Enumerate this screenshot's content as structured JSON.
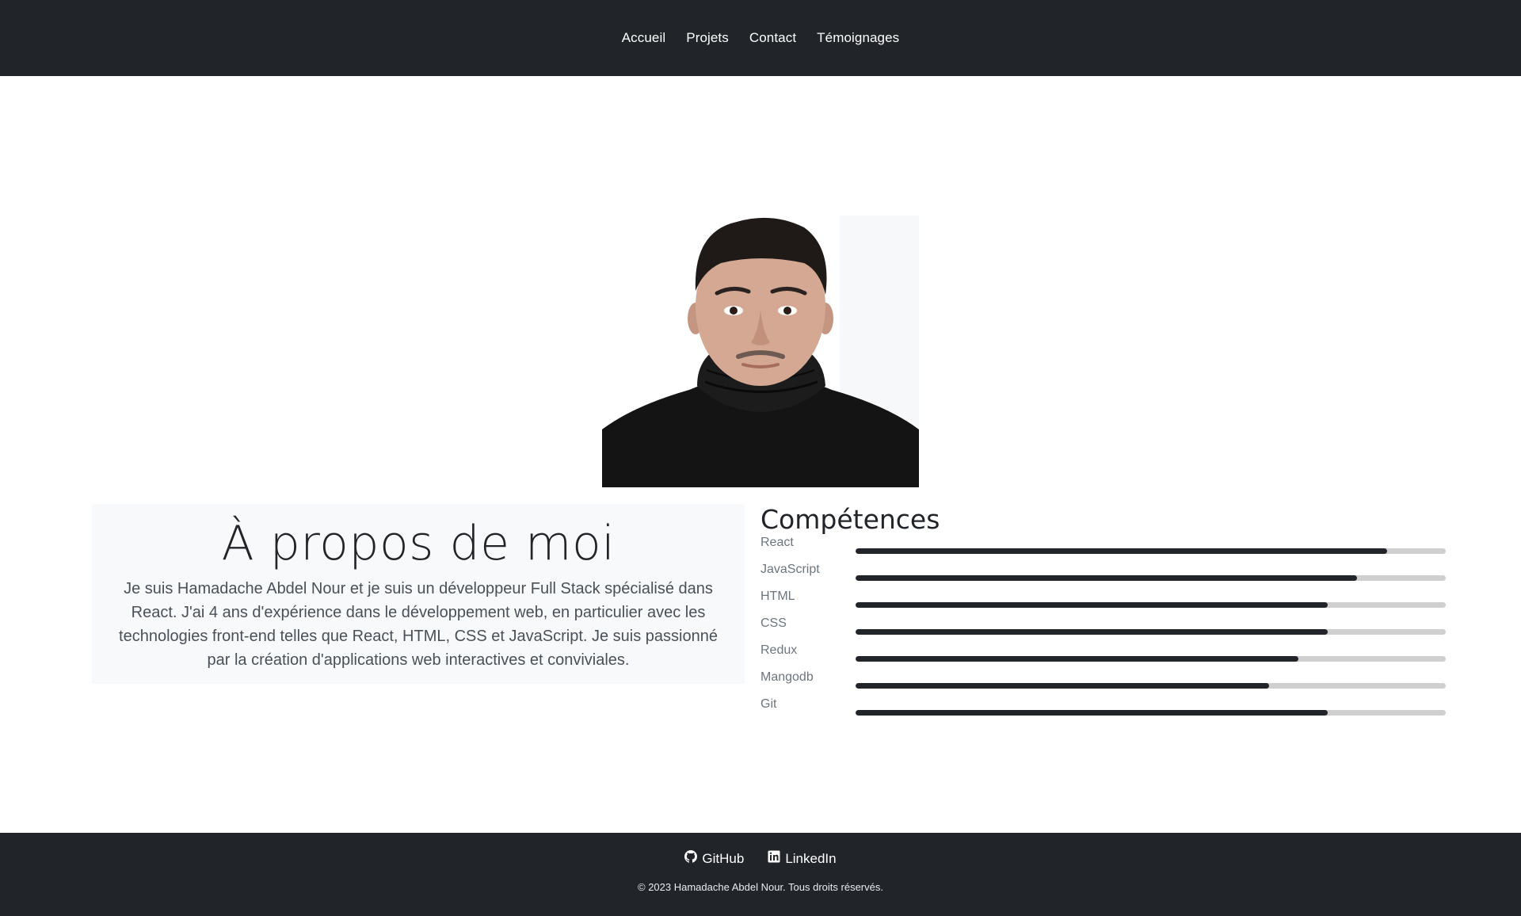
{
  "nav": {
    "items": [
      {
        "label": "Accueil"
      },
      {
        "label": "Projets"
      },
      {
        "label": "Contact"
      },
      {
        "label": "Témoignages"
      }
    ]
  },
  "about": {
    "title": "À propos de moi",
    "text": "Je suis Hamadache Abdel Nour et je suis un développeur Full Stack spécialisé dans React. J'ai 4 ans d'expérience dans le développement web, en particulier avec les technologies front-end telles que React, HTML, CSS et JavaScript. Je suis passionné par la création d'applications web interactives et conviviales."
  },
  "skills": {
    "title": "Compétences",
    "items": [
      {
        "name": "React",
        "level": 90
      },
      {
        "name": "JavaScript",
        "level": 85
      },
      {
        "name": "HTML",
        "level": 80
      },
      {
        "name": "CSS",
        "level": 80
      },
      {
        "name": "Redux",
        "level": 75
      },
      {
        "name": "Mangodb",
        "level": 70
      },
      {
        "name": "Git",
        "level": 80
      }
    ]
  },
  "footer": {
    "github_label": "GitHub",
    "linkedin_label": "LinkedIn",
    "copyright": "© 2023 Hamadache Abdel Nour. Tous droits réservés."
  },
  "colors": {
    "dark": "#212529",
    "track": "#cfcfcf"
  },
  "icons": {
    "github": "github-icon",
    "linkedin": "linkedin-icon"
  }
}
